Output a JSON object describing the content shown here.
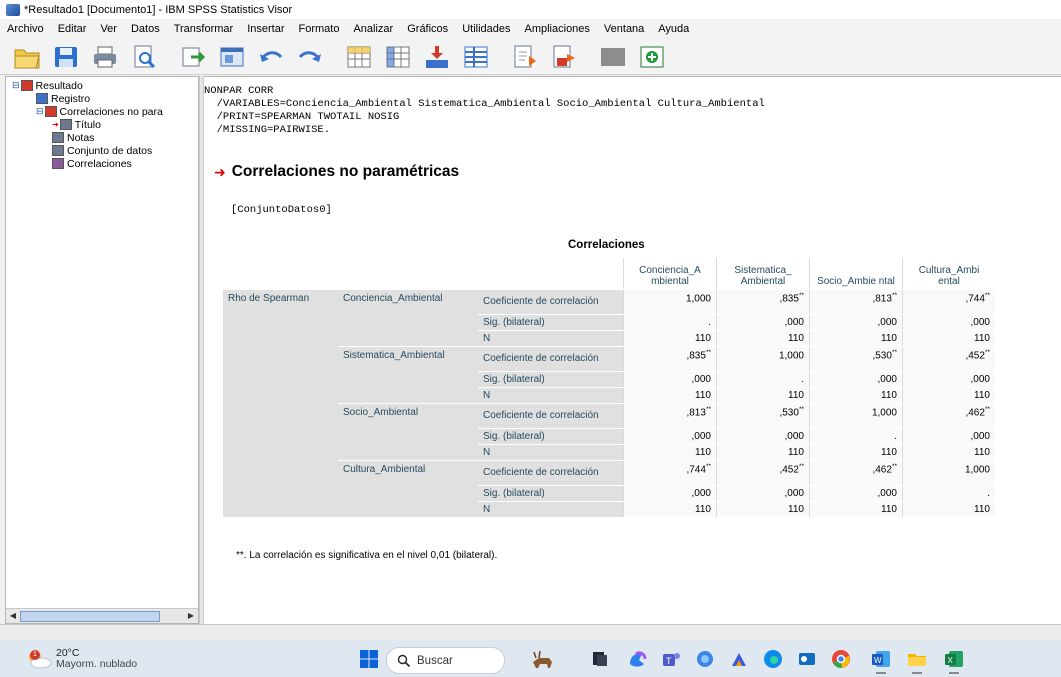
{
  "window": {
    "title": "*Resultado1 [Documento1] - IBM SPSS Statistics Visor"
  },
  "menu": [
    "Archivo",
    "Editar",
    "Ver",
    "Datos",
    "Transformar",
    "Insertar",
    "Formato",
    "Analizar",
    "Gráficos",
    "Utilidades",
    "Ampliaciones",
    "Ventana",
    "Ayuda"
  ],
  "toolbar": {
    "icons": [
      "open-icon",
      "save-icon",
      "print-icon",
      "print-preview-icon",
      "export-icon",
      "recall-dialog-icon",
      "undo-icon",
      "redo-icon",
      "goto-data-icon",
      "goto-variable-icon",
      "variables-icon",
      "show-all-icon",
      "insert-heading-icon",
      "insert-text-icon",
      "designate-window-icon",
      "run-script-icon"
    ]
  },
  "outline": {
    "items": [
      {
        "label": "Resultado",
        "level": 0
      },
      {
        "label": "Registro",
        "level": 1
      },
      {
        "label": "Correlaciones no para",
        "level": 1
      },
      {
        "label": "Título",
        "level": 2
      },
      {
        "label": "Notas",
        "level": 2
      },
      {
        "label": "Conjunto de datos",
        "level": 2
      },
      {
        "label": "Correlaciones",
        "level": 2
      }
    ]
  },
  "syntax": [
    "NONPAR CORR",
    "  /VARIABLES=Conciencia_Ambiental Sistematica_Ambiental Socio_Ambiental Cultura_Ambiental",
    "  /PRINT=SPEARMAN TWOTAIL NOSIG",
    "  /MISSING=PAIRWISE."
  ],
  "section_heading": "Correlaciones no paramétricas",
  "dataset_label": "[ConjuntoDatos0]",
  "table": {
    "caption": "Correlaciones",
    "row_header": "Rho de Spearman",
    "columns": [
      "Conciencia_A mbiental",
      "Sistematica_ Ambiental",
      "Socio_Ambie ntal",
      "Cultura_Ambi ental"
    ],
    "stat_labels": [
      "Coeficiente de correlación",
      "Sig. (bilateral)",
      "N"
    ],
    "rows": [
      {
        "var": "Conciencia_Ambiental",
        "coef": [
          {
            "v": "1,000",
            "s": ""
          },
          {
            "v": ",835",
            "s": "**"
          },
          {
            "v": ",813",
            "s": "**"
          },
          {
            "v": ",744",
            "s": "**"
          }
        ],
        "sig": [
          ".",
          ",000",
          ",000",
          ",000"
        ],
        "n": [
          "110",
          "110",
          "110",
          "110"
        ]
      },
      {
        "var": "Sistematica_Ambiental",
        "coef": [
          {
            "v": ",835",
            "s": "**"
          },
          {
            "v": "1,000",
            "s": ""
          },
          {
            "v": ",530",
            "s": "**"
          },
          {
            "v": ",452",
            "s": "**"
          }
        ],
        "sig": [
          ",000",
          ".",
          ",000",
          ",000"
        ],
        "n": [
          "110",
          "110",
          "110",
          "110"
        ]
      },
      {
        "var": "Socio_Ambiental",
        "coef": [
          {
            "v": ",813",
            "s": "**"
          },
          {
            "v": ",530",
            "s": "**"
          },
          {
            "v": "1,000",
            "s": ""
          },
          {
            "v": ",462",
            "s": "**"
          }
        ],
        "sig": [
          ",000",
          ",000",
          ".",
          ",000"
        ],
        "n": [
          "110",
          "110",
          "110",
          "110"
        ]
      },
      {
        "var": "Cultura_Ambiental",
        "coef": [
          {
            "v": ",744",
            "s": "**"
          },
          {
            "v": ",452",
            "s": "**"
          },
          {
            "v": ",462",
            "s": "**"
          },
          {
            "v": "1,000",
            "s": ""
          }
        ],
        "sig": [
          ",000",
          ",000",
          ",000",
          "."
        ],
        "n": [
          "110",
          "110",
          "110",
          "110"
        ]
      }
    ],
    "footnote": "**. La correlación es significativa en el nivel 0,01 (bilateral)."
  },
  "taskbar": {
    "weather_temp": "20°C",
    "weather_desc": "Mayorm. nublado",
    "weather_badge": "1",
    "search_placeholder": "Buscar"
  },
  "colors": {
    "header_text": "#264a60",
    "row_header_bg": "#e0e0e0",
    "arrow": "#e00000"
  }
}
